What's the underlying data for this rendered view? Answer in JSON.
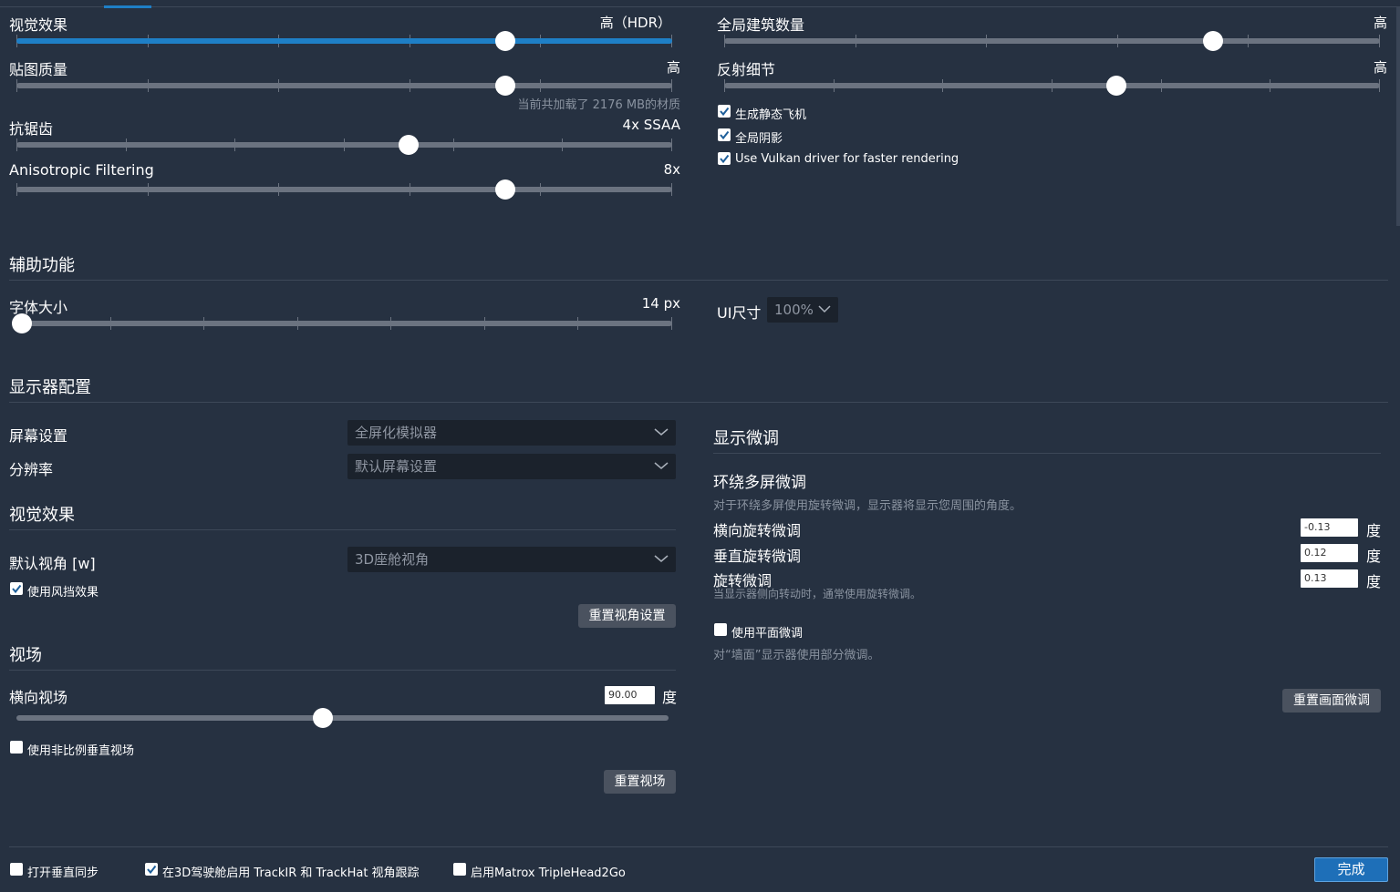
{
  "graphics": {
    "visual_effects": {
      "label": "视觉效果",
      "value": "高（HDR）",
      "level": 0.75
    },
    "texture_quality": {
      "label": "贴图质量",
      "value": "高",
      "level": 0.75,
      "note": "当前共加载了 2176 MB的材质"
    },
    "antialiasing": {
      "label": "抗锯齿",
      "value": "4x SSAA",
      "level": 0.6
    },
    "anisotropic": {
      "label": "Anisotropic Filtering",
      "value": "8x",
      "level": 0.75
    },
    "global_buildings": {
      "label": "全局建筑数量",
      "value": "高",
      "level": 0.75
    },
    "reflection_detail": {
      "label": "反射细节",
      "value": "高",
      "level": 0.6
    },
    "checkboxes": [
      {
        "label": "生成静态飞机",
        "checked": true
      },
      {
        "label": "全局阴影",
        "checked": true
      },
      {
        "label": "Use Vulkan driver for faster rendering",
        "checked": true
      }
    ]
  },
  "accessibility": {
    "title": "辅助功能",
    "font_size": {
      "label": "字体大小",
      "value": "14 px",
      "level": 0.0
    },
    "ui_size": {
      "label": "UI尺寸",
      "value": "100%"
    }
  },
  "monitor": {
    "title": "显示器配置",
    "screen_setting": {
      "label": "屏幕设置",
      "value": "全屏化模拟器"
    },
    "resolution": {
      "label": "分辨率",
      "value": "默认屏幕设置"
    },
    "visual_title": "视觉效果",
    "default_view": {
      "label": "默认视角 [w]",
      "value": "3D座舱视角"
    },
    "windshield": {
      "label": "使用风挡效果",
      "checked": true
    },
    "reset_view_button": "重置视角设置",
    "fov_title": "视场",
    "horizontal_fov": {
      "label": "横向视场",
      "value": "90.00",
      "unit": "度",
      "level": 0.47
    },
    "nonproportional": {
      "label": "使用非比例垂直视场",
      "checked": false
    },
    "reset_fov_button": "重置视场"
  },
  "fine_tune": {
    "title": "显示微调",
    "surround_title": "环绕多屏微调",
    "surround_desc": "对于环绕多屏使用旋转微调，显示器将显示您周围的角度。",
    "rows": [
      {
        "label": "横向旋转微调",
        "value": "-0.13",
        "unit": "度"
      },
      {
        "label": "垂直旋转微调",
        "value": "0.12",
        "unit": "度"
      },
      {
        "label": "旋转微调",
        "value": "0.13",
        "unit": "度"
      }
    ],
    "rotate_note": "当显示器侧向转动时，通常使用旋转微调。",
    "flat": {
      "label": "使用平面微调",
      "checked": false
    },
    "flat_desc": "对“墙面”显示器使用部分微调。",
    "reset_button": "重置画面微调"
  },
  "footer": {
    "vsync": {
      "label": "打开垂直同步",
      "checked": false
    },
    "trackir": {
      "label": "在3D驾驶舱启用 TrackIR 和 TrackHat 视角跟踪",
      "checked": true
    },
    "matrox": {
      "label": "启用Matrox TripleHead2Go",
      "checked": false
    },
    "done_button": "完成"
  },
  "colors": {
    "background": "#263141",
    "accent": "#1e7fc6",
    "track": "#6b7380"
  }
}
